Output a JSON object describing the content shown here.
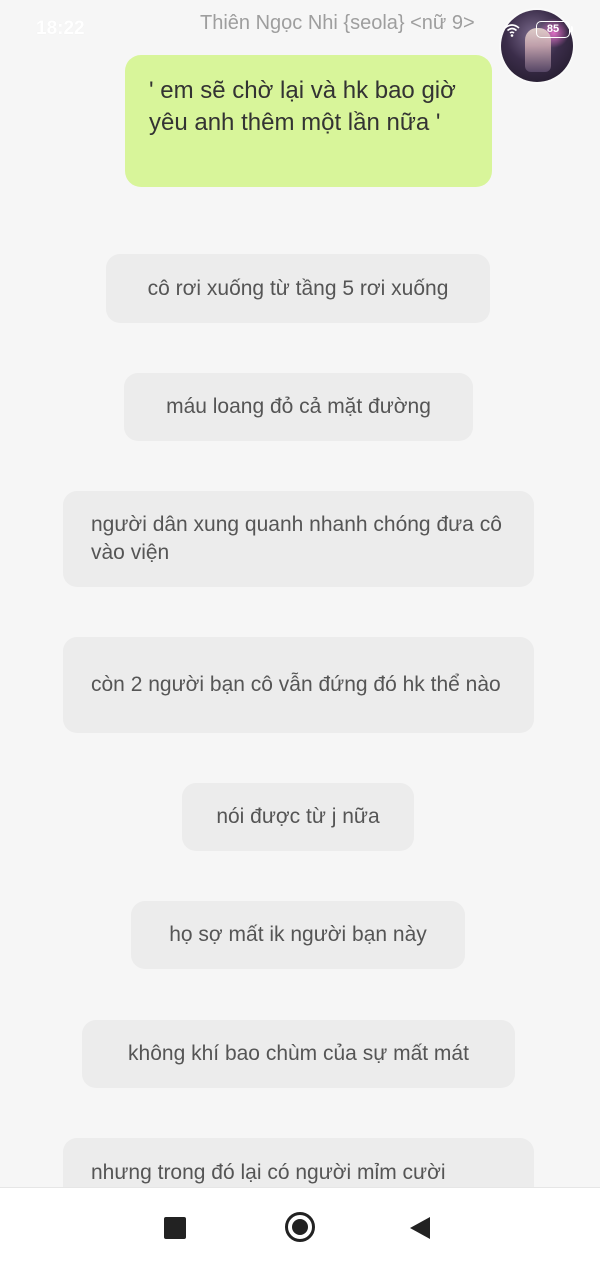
{
  "status": {
    "time": "18:22",
    "battery": "85",
    "wifi_icon": "wifi-icon"
  },
  "header": {
    "sender_name": "Thiên Ngọc Nhi {seola} <nữ 9>",
    "avatar": "avatar"
  },
  "messages": [
    "' em sẽ chờ lại và hk bao giờ yêu anh thêm một lần nữa '",
    "cô rơi xuống từ tầng 5 rơi xuống",
    "máu loang đỏ cả mặt đường",
    "người dân xung quanh nhanh chóng đưa cô vào viện",
    "còn 2 người bạn cô vẫn đứng đó hk thể nào",
    "nói được từ j nữa",
    "họ sợ mất ik người bạn này",
    "không khí bao chùm của sự mất mát",
    "nhưng trong đó lại có người mỉm cười"
  ],
  "colors": {
    "background": "#f6f6f6",
    "bubble_gray": "#ececec",
    "bubble_green": "#d8f59a",
    "text": "#555555"
  },
  "navbar": {
    "recents_icon": "square-icon",
    "home_icon": "circle-home-icon",
    "back_icon": "triangle-back-icon"
  }
}
